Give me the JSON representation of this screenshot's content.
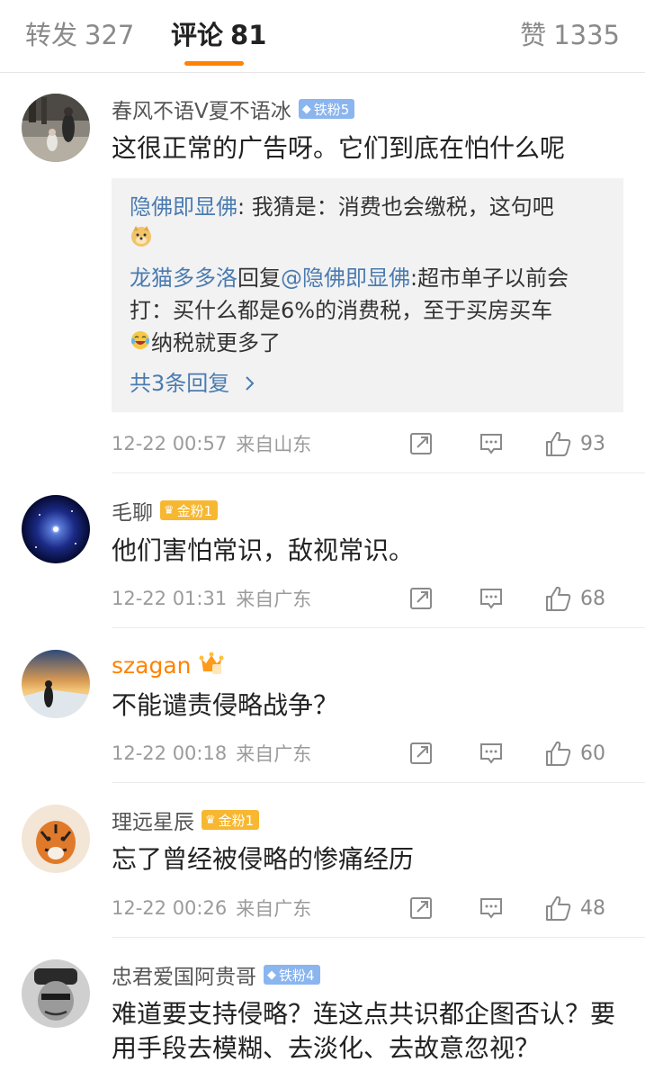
{
  "tabs": {
    "repost": {
      "label": "转发",
      "count": "327"
    },
    "comment": {
      "label": "评论",
      "count": "81"
    },
    "like": {
      "label": "赞",
      "count": "1335"
    }
  },
  "accent": "#ff8200",
  "comments": [
    {
      "username": "春风不语V夏不语冰",
      "badge": "铁粉5",
      "badge_type": "iron",
      "text": "这很正常的广告呀。它们到底在怕什么呢",
      "replies": [
        {
          "user": "隐佛即显佛",
          "sep": ": ",
          "text": "我猜是：消费也会缴税，这句吧",
          "emoji": "doge"
        },
        {
          "user": "龙猫多多洛",
          "reply_word": "回复",
          "reply_to": "@隐佛即显佛",
          "sep": ":",
          "text": "超市单子以前会打：买什么都是6%的消费税，至于买房买车",
          "emoji": "laugh-cry",
          "text2": "纳税就更多了"
        }
      ],
      "more_replies": "共3条回复",
      "time": "12-22 00:57",
      "source": "来自山东",
      "likes": "93"
    },
    {
      "username": "毛聊",
      "badge": "金粉1",
      "badge_type": "gold",
      "text": "他们害怕常识，敌视常识。",
      "time": "12-22 01:31",
      "source": "来自广东",
      "likes": "68"
    },
    {
      "username": "szagan",
      "badge_type": "crown",
      "text": "不能谴责侵略战争？",
      "time": "12-22 00:18",
      "source": "来自广东",
      "likes": "60"
    },
    {
      "username": "理远星辰",
      "badge": "金粉1",
      "badge_type": "gold",
      "text": "忘了曾经被侵略的惨痛经历",
      "time": "12-22 00:26",
      "source": "来自广东",
      "likes": "48"
    },
    {
      "username": "忠君爱国阿贵哥",
      "badge": "铁粉4",
      "badge_type": "iron",
      "text": "难道要支持侵略？连这点共识都企图否认？要用手段去模糊、去淡化、去故意忽视？"
    }
  ]
}
